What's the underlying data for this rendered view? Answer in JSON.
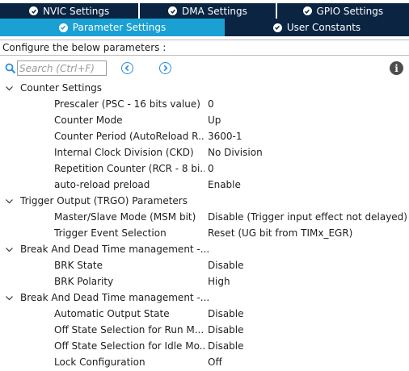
{
  "tabs_row1": [
    {
      "label": "NVIC Settings",
      "active": false
    },
    {
      "label": "DMA Settings",
      "active": false
    },
    {
      "label": "GPIO Settings",
      "active": false
    }
  ],
  "tabs_row2": [
    {
      "label": "Parameter Settings",
      "active": true
    },
    {
      "label": "User Constants",
      "active": false
    }
  ],
  "configure_text": "Configure the below parameters :",
  "search": {
    "placeholder": "Search (Ctrl+F)"
  },
  "groups": [
    {
      "label": "Counter Settings",
      "params": [
        {
          "name": "Prescaler (PSC - 16 bits value)",
          "value": "0"
        },
        {
          "name": "Counter Mode",
          "value": "Up"
        },
        {
          "name": "Counter Period (AutoReload R...",
          "value": "3600-1"
        },
        {
          "name": "Internal Clock Division (CKD)",
          "value": "No Division"
        },
        {
          "name": "Repetition Counter (RCR - 8 bi...",
          "value": "0"
        },
        {
          "name": "auto-reload preload",
          "value": "Enable"
        }
      ]
    },
    {
      "label": "Trigger Output (TRGO) Parameters",
      "params": [
        {
          "name": "Master/Slave Mode (MSM bit)",
          "value": "Disable (Trigger input effect not delayed)"
        },
        {
          "name": "Trigger Event Selection",
          "value": "Reset (UG bit from TIMx_EGR)"
        }
      ]
    },
    {
      "label": "Break And Dead Time management -...",
      "params": [
        {
          "name": "BRK State",
          "value": "Disable"
        },
        {
          "name": "BRK Polarity",
          "value": "High"
        }
      ]
    },
    {
      "label": "Break And Dead Time management -...",
      "params": [
        {
          "name": "Automatic Output State",
          "value": "Disable"
        },
        {
          "name": "Off State Selection for Run M...",
          "value": "Disable"
        },
        {
          "name": "Off State Selection for Idle Mo...",
          "value": "Disable"
        },
        {
          "name": "Lock Configuration",
          "value": "Off"
        }
      ]
    }
  ],
  "colors": {
    "tab_dark": "#0a2441",
    "tab_active": "#1aa0d2",
    "accent": "#2a8be0"
  }
}
